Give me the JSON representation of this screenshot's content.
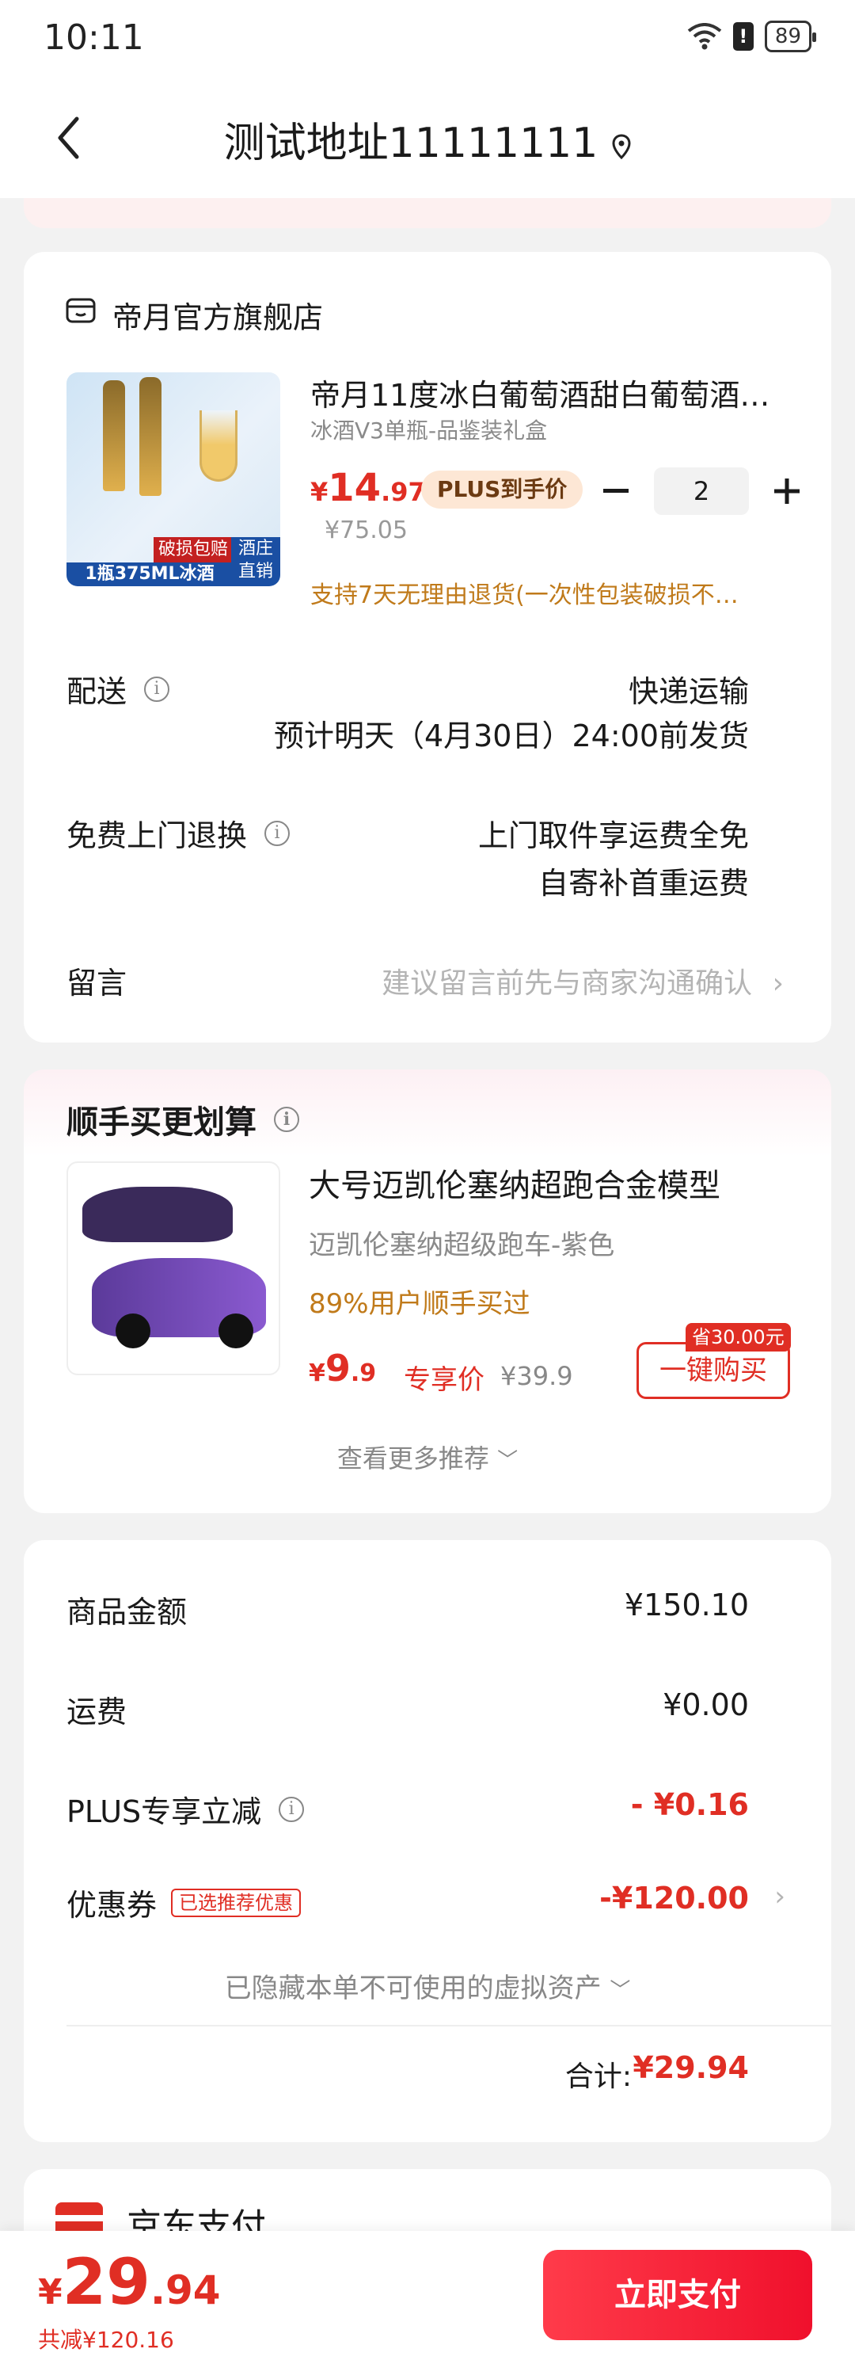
{
  "status": {
    "time": "10:11",
    "battery": "89"
  },
  "nav": {
    "title": "测试地址11111111"
  },
  "store": {
    "name": "帝月官方旗舰店",
    "product": {
      "title": "帝月11度冰白葡萄酒甜白葡萄酒…",
      "spec": "冰酒V3单瓶-品鉴装礼盒",
      "price_currency": "¥",
      "price_int": "14",
      "price_dec": ".97",
      "plus_badge": "PLUS到手价",
      "original_price": "¥75.05",
      "quantity": "2",
      "return_note": "支持7天无理由退货(一次性包装破损不…",
      "image_tags": {
        "bottom": "1瓶375ML冰酒",
        "damage": "破损包赔",
        "corner": "酒庄直销"
      }
    },
    "delivery": {
      "label": "配送",
      "method": "快递运输",
      "eta": "预计明天（4月30日）24:00前发货"
    },
    "free_return": {
      "label": "免费上门退换",
      "line1": "上门取件享运费全免",
      "line2": "自寄补首重运费"
    },
    "message": {
      "label": "留言",
      "placeholder": "建议留言前先与商家沟通确认"
    }
  },
  "recommend": {
    "title": "顺手买更划算",
    "name": "大号迈凯伦塞纳超跑合金模型",
    "sub": "迈凯伦塞纳超级跑车-紫色",
    "pct": "89%用户顺手买过",
    "price_currency": "¥",
    "price_int": "9",
    "price_dec": ".9",
    "exclusive": "专享价",
    "original": "¥39.9",
    "save_tag": "省30.00元",
    "buy": "一键购买",
    "more": "查看更多推荐"
  },
  "summary": {
    "goods_label": "商品金额",
    "goods_value": "¥150.10",
    "ship_label": "运费",
    "ship_value": "¥0.00",
    "plus_label": "PLUS专享立减",
    "plus_value": "- ¥0.16",
    "coupon_label": "优惠券",
    "coupon_tag": "已选推荐优惠",
    "coupon_value": "-¥120.00",
    "hidden": "已隐藏本单不可使用的虚拟资产",
    "total_label": "合计:",
    "total_value": "¥29.94"
  },
  "payment": {
    "name": "京东支付"
  },
  "bottom": {
    "currency": "¥",
    "int": "29",
    "dec": ".94",
    "saved": "共减¥120.16",
    "pay_button": "立即支付"
  },
  "colors": {
    "accent": "#e02e24",
    "note": "#c07a1a",
    "plus_bg": "#fde7d5"
  }
}
